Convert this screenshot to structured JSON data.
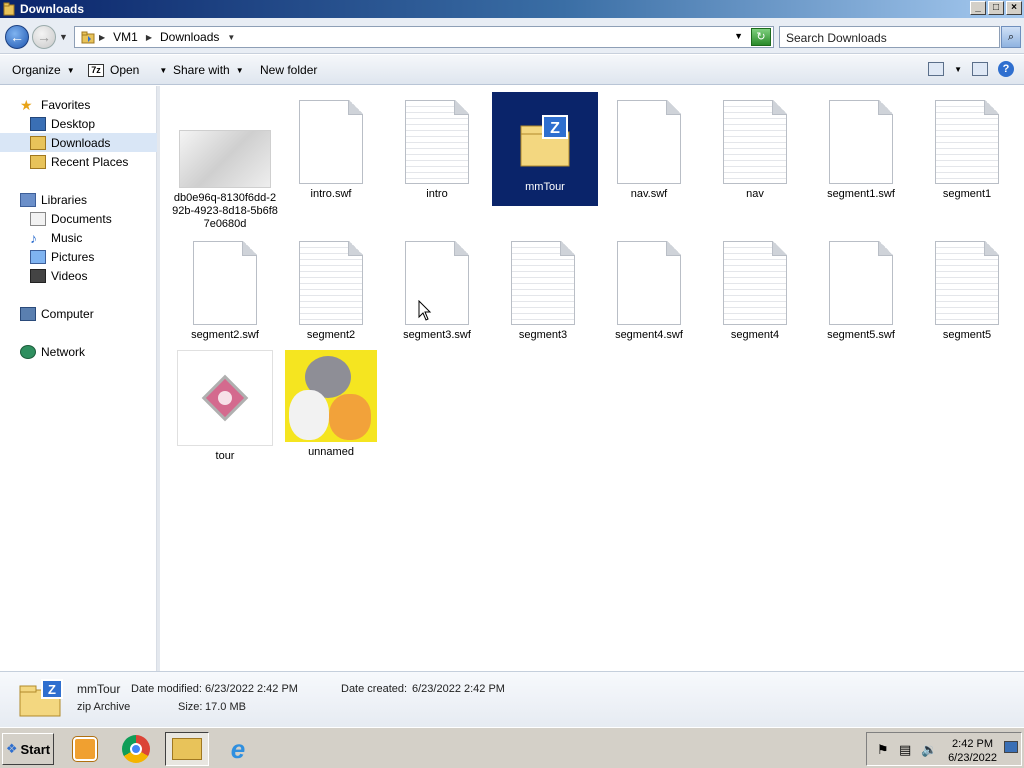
{
  "window": {
    "title": "Downloads",
    "controls": [
      "_",
      "□",
      "×"
    ]
  },
  "address": {
    "crumbs": [
      "VM1",
      "Downloads"
    ],
    "search_placeholder": "Search Downloads"
  },
  "toolbar": {
    "organize": "Organize",
    "open": "Open",
    "share_with": "Share with",
    "new_folder": "New folder"
  },
  "nav": {
    "favorites": "Favorites",
    "desktop": "Desktop",
    "downloads": "Downloads",
    "recent_places": "Recent Places",
    "libraries": "Libraries",
    "documents": "Documents",
    "music": "Music",
    "pictures": "Pictures",
    "videos": "Videos",
    "computer": "Computer",
    "network": "Network"
  },
  "files": [
    {
      "name": "db0e96q-8130f6dd-292b-4923-8d18-5b6f87e0680d",
      "kind": "image"
    },
    {
      "name": "intro.swf",
      "kind": "blank"
    },
    {
      "name": "intro",
      "kind": "lined"
    },
    {
      "name": "mmTour",
      "kind": "zip",
      "selected": true
    },
    {
      "name": "nav.swf",
      "kind": "blank"
    },
    {
      "name": "nav",
      "kind": "lined"
    },
    {
      "name": "segment1.swf",
      "kind": "blank"
    },
    {
      "name": "segment1",
      "kind": "lined"
    },
    {
      "name": "segment2.swf",
      "kind": "blank"
    },
    {
      "name": "segment2",
      "kind": "lined"
    },
    {
      "name": "segment3.swf",
      "kind": "blank"
    },
    {
      "name": "segment3",
      "kind": "lined"
    },
    {
      "name": "segment4.swf",
      "kind": "blank"
    },
    {
      "name": "segment4",
      "kind": "lined"
    },
    {
      "name": "segment5.swf",
      "kind": "blank"
    },
    {
      "name": "segment5",
      "kind": "lined"
    },
    {
      "name": "tour",
      "kind": "app"
    },
    {
      "name": "unnamed",
      "kind": "photo"
    }
  ],
  "details": {
    "name": "mmTour",
    "type": "zip Archive",
    "date_modified_label": "Date modified:",
    "date_modified": "6/23/2022 2:42 PM",
    "date_created_label": "Date created:",
    "date_created": "6/23/2022 2:42 PM",
    "size_label": "Size:",
    "size": "17.0 MB"
  },
  "taskbar": {
    "start": "Start",
    "time": "2:42 PM",
    "date": "6/23/2022"
  },
  "colors": {
    "selection": "#0a246a",
    "title_gradient_start": "#0a246a",
    "title_gradient_end": "#a6caf0"
  }
}
